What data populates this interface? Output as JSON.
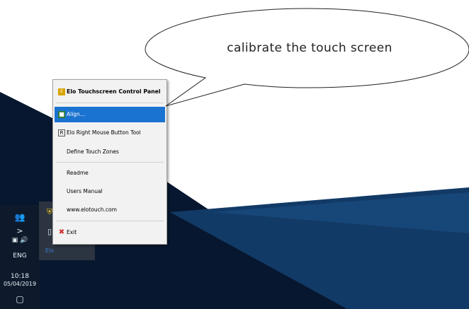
{
  "callout": {
    "text": "calibrate the touch screen"
  },
  "context_menu": {
    "title": "Elo Touchscreen Control Panel",
    "items": [
      {
        "label": "Align...",
        "icon": "align-icon",
        "selected": true
      },
      {
        "label": "Elo Right Mouse Button Tool",
        "icon": "right-mouse-icon"
      },
      {
        "label": "Define Touch Zones"
      },
      {
        "label": "Readme"
      },
      {
        "label": "Users Manual"
      },
      {
        "label": "www.elotouch.com"
      },
      {
        "label": "Exit",
        "icon": "close-icon"
      }
    ]
  },
  "taskbar": {
    "expand_glyph": ">",
    "language": "ENG",
    "time": "10:18",
    "date": "05/04/2019"
  },
  "colors": {
    "taskbar": "#0e1a2b",
    "menu_highlight": "#1a73d0",
    "wallpaper_dark": "#0a1a33",
    "exit_red": "#d32f2f"
  }
}
